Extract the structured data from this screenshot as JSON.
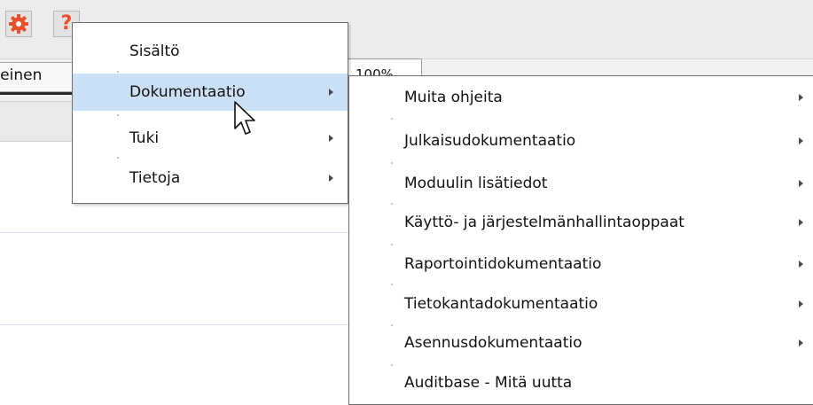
{
  "toolbar": {
    "settings_icon": "gear-icon",
    "help_icon": "question-mark-icon",
    "help_glyph": "?",
    "accent_color": "#e8512a"
  },
  "tabs": {
    "active_tab_label": "eleinen",
    "zoom_text": "100%"
  },
  "help_menu": {
    "items": [
      {
        "label": "Sisältö",
        "has_submenu": false
      },
      {
        "label": "Dokumentaatio",
        "has_submenu": true,
        "highlighted": true
      },
      {
        "label": "Tuki",
        "has_submenu": true
      },
      {
        "label": "Tietoja",
        "has_submenu": true
      }
    ]
  },
  "documentation_submenu": {
    "items": [
      {
        "label": "Muita ohjeita",
        "has_submenu": true
      },
      {
        "label": "Julkaisudokumentaatio",
        "has_submenu": true
      },
      {
        "label": "Moduulin lisätiedot",
        "has_submenu": true
      },
      {
        "label": "Käyttö- ja järjestelmänhallintaoppaat",
        "has_submenu": true
      },
      {
        "label": "Raportointidokumentaatio",
        "has_submenu": true
      },
      {
        "label": "Tietokantadokumentaatio",
        "has_submenu": true
      },
      {
        "label": "Asennusdokumentaatio",
        "has_submenu": true
      },
      {
        "label": "Auditbase - Mitä uutta",
        "has_submenu": false
      }
    ]
  },
  "colors": {
    "highlight": "#cce0f5",
    "menu_border": "#6e6e6e"
  },
  "cursor_icon": "arrow-pointer-icon"
}
